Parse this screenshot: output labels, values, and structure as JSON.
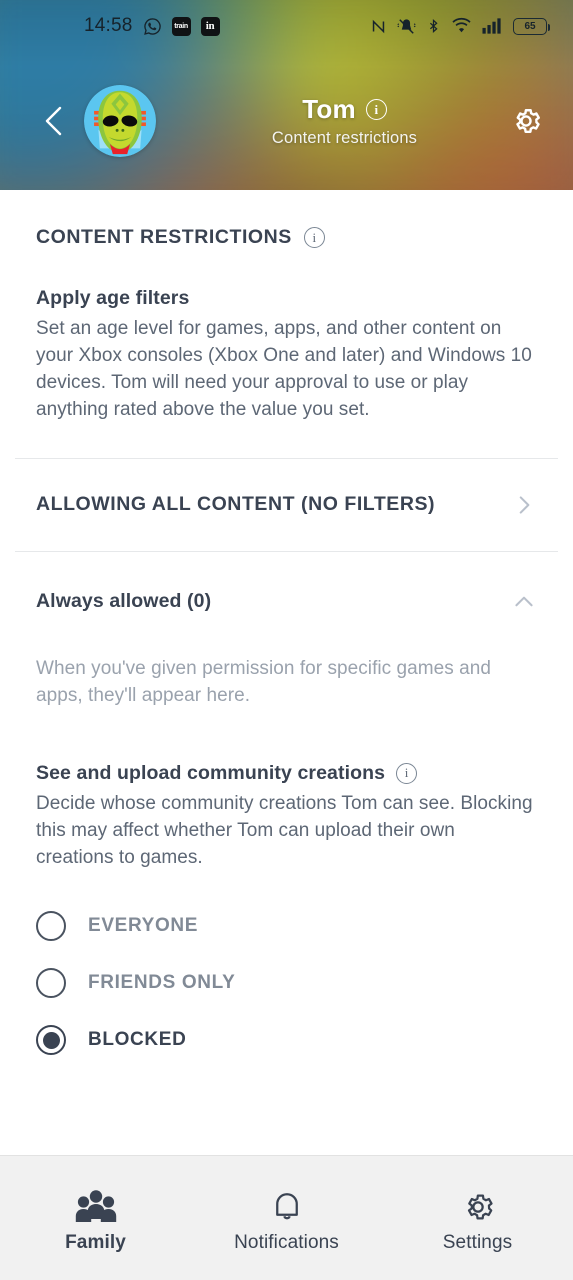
{
  "statusbar": {
    "time": "14:58",
    "left_icons": [
      {
        "name": "whatsapp-icon",
        "label": ""
      },
      {
        "name": "trainline-app-icon",
        "label": "train"
      },
      {
        "name": "linkedin-app-icon",
        "label": "in"
      }
    ],
    "right_icons": [
      "nfc-icon",
      "mute-bell-icon",
      "bluetooth-icon",
      "wifi-icon",
      "cellular-signal-icon"
    ],
    "battery_level": "65"
  },
  "header": {
    "back_label": "Back",
    "profile_name": "Tom",
    "subtitle": "Content restrictions",
    "info_glyph": "i",
    "settings_label": "Settings"
  },
  "main": {
    "section_title": "CONTENT RESTRICTIONS",
    "age_filters": {
      "heading": "Apply age filters",
      "description": "Set an age level for games, apps, and other content on your Xbox consoles (Xbox One and later) and Windows 10 devices. Tom will need your approval to use or play anything rated above the value you set."
    },
    "filter_row": {
      "label": "ALLOWING ALL CONTENT (NO FILTERS)"
    },
    "always_allowed": {
      "label": "Always allowed (0)",
      "empty_text": "When you've given permission for specific games and apps, they'll appear here."
    },
    "community_creations": {
      "heading": "See and upload community creations",
      "description": "Decide whose community creations Tom can see. Blocking this may affect whether Tom can upload their own creations to games.",
      "options": [
        {
          "label": "EVERYONE",
          "selected": false
        },
        {
          "label": "FRIENDS ONLY",
          "selected": false
        },
        {
          "label": "BLOCKED",
          "selected": true
        }
      ]
    }
  },
  "bottom_nav": {
    "items": [
      {
        "label": "Family",
        "icon": "family-icon",
        "active": true
      },
      {
        "label": "Notifications",
        "icon": "bell-icon",
        "active": false
      },
      {
        "label": "Settings",
        "icon": "gear-icon",
        "active": false
      }
    ]
  },
  "colors": {
    "text_dark": "#3a4352",
    "text_muted": "#5d6775",
    "text_light": "#9aa2ad",
    "nav_bg": "#f1f1f1",
    "divider": "#e6e8ea"
  }
}
